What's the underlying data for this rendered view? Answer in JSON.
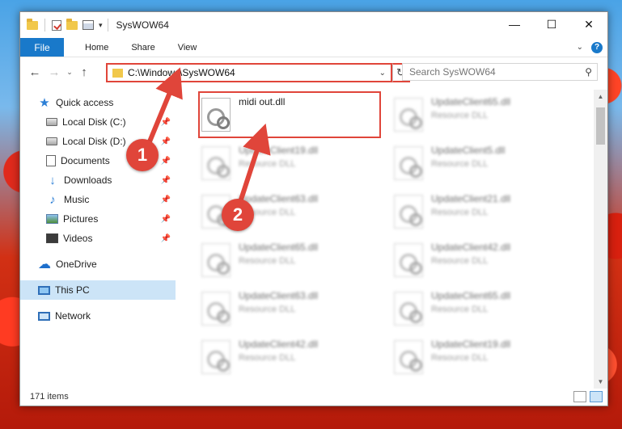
{
  "window": {
    "title": "SysWOW64",
    "minimize": "—",
    "maximize": "☐",
    "close": "✕"
  },
  "ribbon": {
    "file": "File",
    "home": "Home",
    "share": "Share",
    "view": "View"
  },
  "address": {
    "path": "C:\\Windows\\SysWOW64",
    "search_placeholder": "Search SysWOW64"
  },
  "sidebar": {
    "items": [
      {
        "label": "Quick access"
      },
      {
        "label": "Local Disk (C:)"
      },
      {
        "label": "Local Disk (D:)"
      },
      {
        "label": "Documents"
      },
      {
        "label": "Downloads"
      },
      {
        "label": "Music"
      },
      {
        "label": "Pictures"
      },
      {
        "label": "Videos"
      },
      {
        "label": "OneDrive"
      },
      {
        "label": "This PC"
      },
      {
        "label": "Network"
      }
    ]
  },
  "files": {
    "col1": [
      {
        "name": "midi out.dll",
        "type": ""
      },
      {
        "name": "UpdateClient19.dll",
        "type": "Resource DLL"
      },
      {
        "name": "UpdateClient63.dll",
        "type": "Resource DLL"
      },
      {
        "name": "UpdateClient65.dll",
        "type": "Resource DLL"
      },
      {
        "name": "UpdateClient63.dll",
        "type": "Resource DLL"
      },
      {
        "name": "UpdateClient42.dll",
        "type": "Resource DLL"
      }
    ],
    "col2": [
      {
        "name": "UpdateClient65.dll",
        "type": "Resource DLL"
      },
      {
        "name": "UpdateClient5.dll",
        "type": "Resource DLL"
      },
      {
        "name": "UpdateClient21.dll",
        "type": "Resource DLL"
      },
      {
        "name": "UpdateClient42.dll",
        "type": "Resource DLL"
      },
      {
        "name": "UpdateClient65.dll",
        "type": "Resource DLL"
      },
      {
        "name": "UpdateClient19.dll",
        "type": "Resource DLL"
      }
    ]
  },
  "status": {
    "count": "171 items"
  },
  "annotations": {
    "step1": "1",
    "step2": "2",
    "color": "#e0453a"
  }
}
